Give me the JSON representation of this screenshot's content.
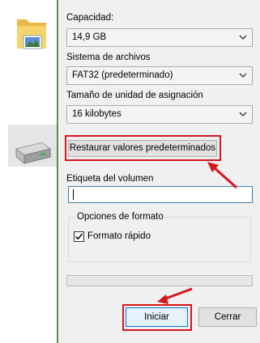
{
  "dialog": {
    "capacity": {
      "label": "Capacidad:",
      "value": "14,9 GB"
    },
    "filesystem": {
      "label": "Sistema de archivos",
      "value": "FAT32 (predeterminado)"
    },
    "allocation": {
      "label": "Tamaño de unidad de asignación",
      "value": "16 kilobytes"
    },
    "restore_button": "Restaurar valores predeterminados",
    "volume": {
      "label": "Etiqueta del volumen",
      "value": ""
    },
    "format_options": {
      "legend": "Opciones de formato",
      "quick_label": "Formato rápido",
      "quick_checked": true
    },
    "progress": 0,
    "start_button": "Iniciar",
    "cancel_button": "Cerrar"
  },
  "icons": [
    "folder-icon",
    "usb-drive-icon",
    "chevron-down-icon",
    "checkmark-icon",
    "red-arrow-annotation"
  ],
  "colors": {
    "highlight": "#d8141d",
    "dialog_bg": "#f0f0f0",
    "focus_border": "#3c7fb1",
    "default_button_border": "#0078d7"
  }
}
